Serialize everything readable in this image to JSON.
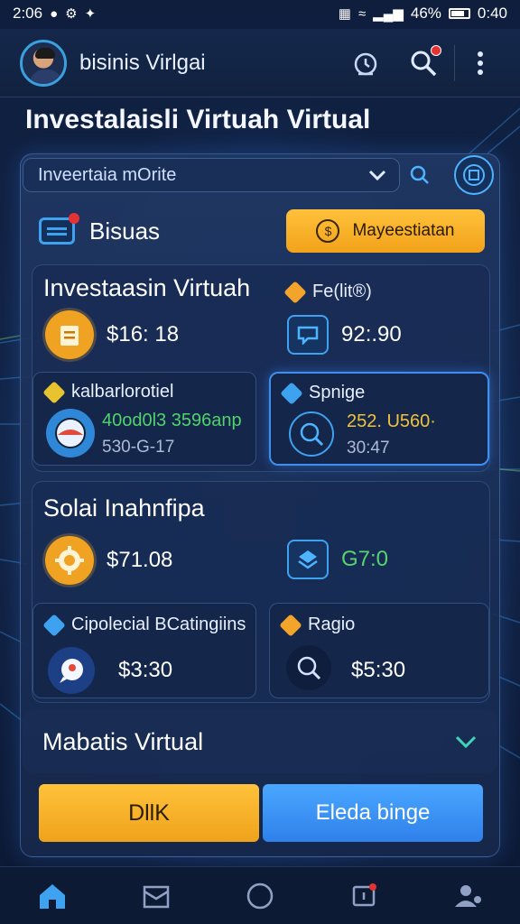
{
  "status_bar": {
    "time_left": "2:06",
    "battery_pct": "46%",
    "time_right": "0:40"
  },
  "app_bar": {
    "title": "bisinis Virlgai"
  },
  "page": {
    "title": "Investalaisli Virtuah Virtual"
  },
  "search": {
    "value": "Inveertaia mOrite"
  },
  "bisuas": {
    "label": "Bisuas",
    "button_label": "Mayeestiatan"
  },
  "panel1": {
    "title": "Investaasin Virtuah",
    "tag_label": "Fe(lit®)",
    "amount": "$16: 18",
    "value": "92:.90",
    "card_left": {
      "label": "kalbarlorotiel",
      "value_green": "40od0l3 3596anp",
      "value_grey": "530-G-17"
    },
    "card_right": {
      "label": "Spnige",
      "value_gold": "252. U560·",
      "value_grey": "30:47"
    }
  },
  "panel2": {
    "title": "Solai Inahnfipa",
    "amount": "$71.08",
    "value": "G7:0",
    "card_left": {
      "label": "Cipolecial BCatingiins",
      "value": "$3:30"
    },
    "card_right": {
      "label": "Ragio",
      "value": "$5:30"
    }
  },
  "collapse": {
    "title": "Mabatis Virtual"
  },
  "actions": {
    "primary_label": "DllK",
    "secondary_label": "Eleda binge"
  },
  "colors": {
    "accent_orange": "#f2a21a",
    "accent_blue": "#3ea2f0",
    "background": "#0d1a36"
  },
  "nav": {
    "items": [
      "home-icon",
      "inbox-icon",
      "circle-icon",
      "notification-icon",
      "profile-icon"
    ]
  }
}
